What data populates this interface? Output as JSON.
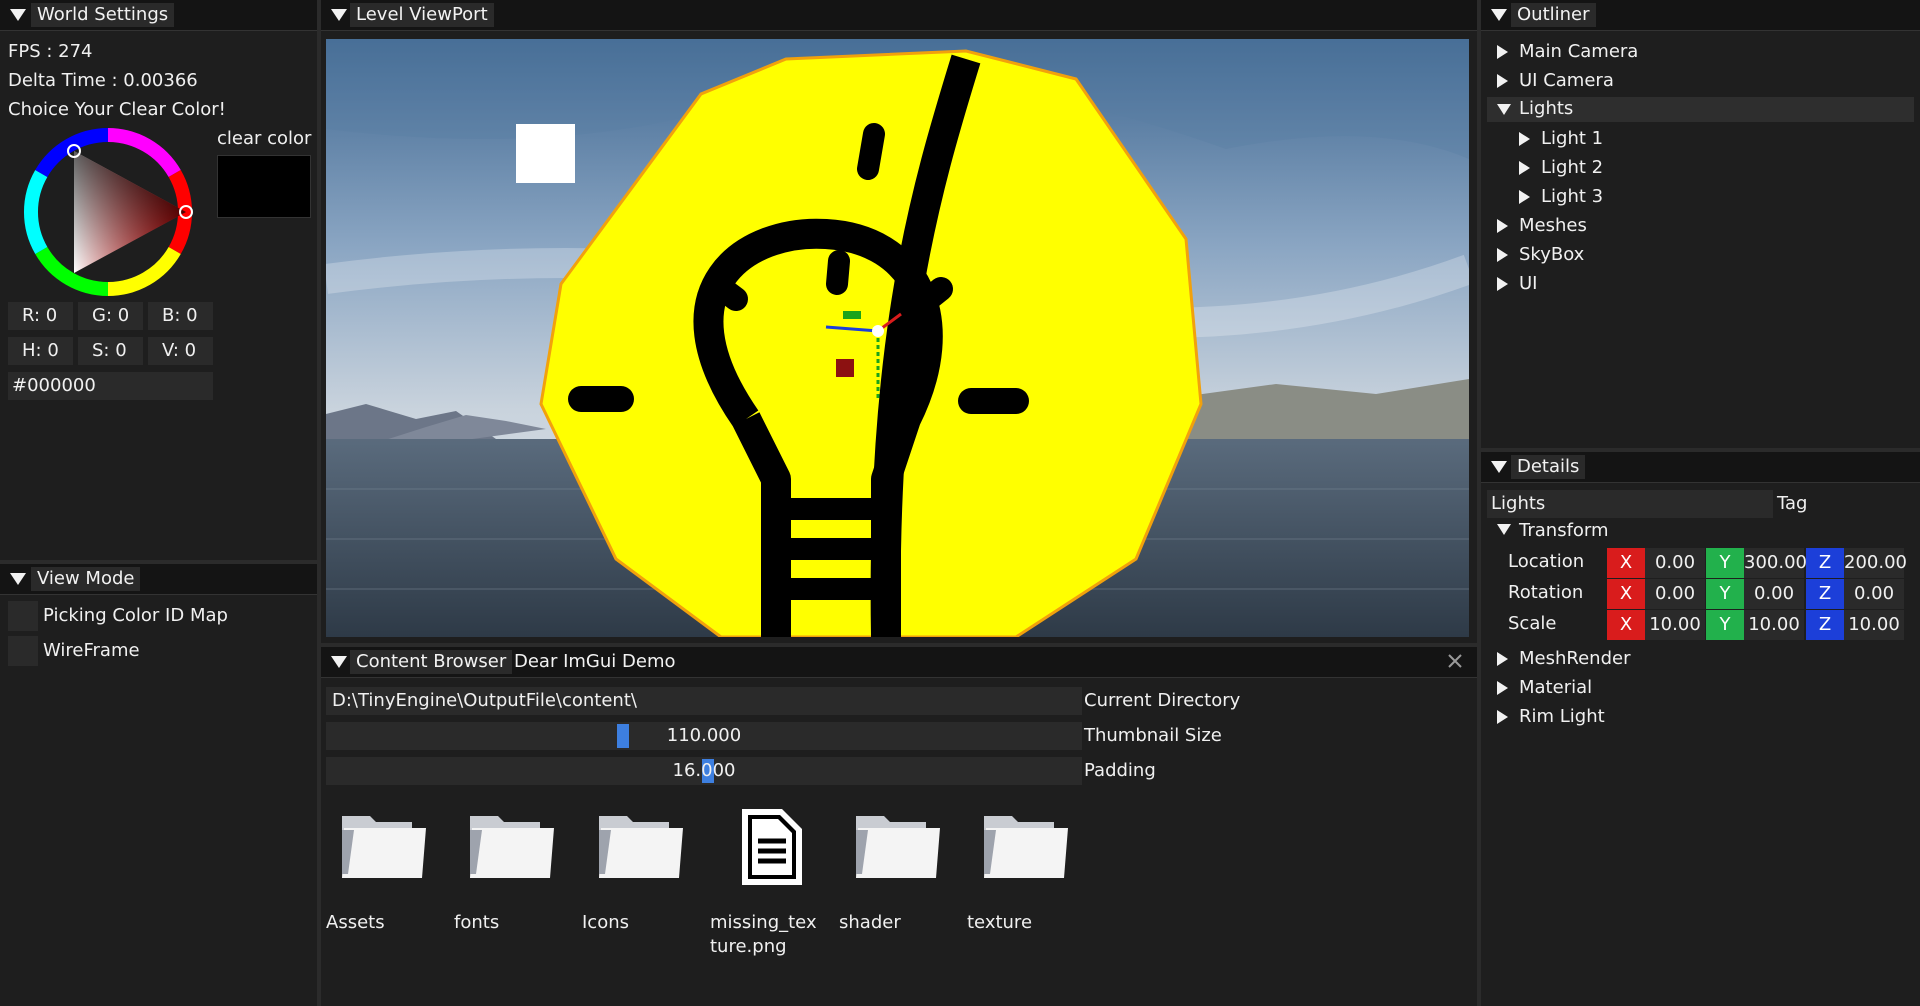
{
  "world_settings": {
    "title": "World Settings",
    "fps": "FPS : 274",
    "delta_time": "Delta Time : 0.00366",
    "choice_label": "Choice Your Clear Color!",
    "clear_color_label": "clear color",
    "r": "R:  0",
    "g": "G:  0",
    "b": "B:  0",
    "h": "H:  0",
    "s": "S:  0",
    "v": "V:  0",
    "hex": "#000000",
    "clear_color_hex": "#000000"
  },
  "view_mode": {
    "title": "View Mode",
    "options": [
      "Picking Color ID Map",
      "WireFrame"
    ]
  },
  "viewport": {
    "title": "Level ViewPort"
  },
  "outliner": {
    "title": "Outliner",
    "items": [
      "Main Camera",
      "UI Camera",
      "Lights",
      "Light 1",
      "Light 2",
      "Light 3",
      "Meshes",
      "SkyBox",
      "UI"
    ]
  },
  "details": {
    "title": "Details",
    "name_value": "Lights",
    "tag_label": "Tag",
    "transform_label": "Transform",
    "rows": [
      {
        "label": "Location",
        "x": "0.00",
        "y": "300.00",
        "z": "200.00"
      },
      {
        "label": "Rotation",
        "x": "0.00",
        "y": "0.00",
        "z": "0.00"
      },
      {
        "label": "Scale",
        "x": "10.00",
        "y": "10.00",
        "z": "10.00"
      }
    ],
    "axis_x": "X",
    "axis_y": "Y",
    "axis_z": "Z",
    "sections": [
      "MeshRender",
      "Material",
      "Rim Light"
    ]
  },
  "content_browser": {
    "tab_active": "Content Browser",
    "tab_other": "Dear ImGui Demo",
    "current_directory_value": "D:\\TinyEngine\\OutputFile\\content\\",
    "current_directory_label": "Current Directory",
    "thumbnail_size_value": "110.000",
    "thumbnail_size_label": "Thumbnail Size",
    "padding_value": "16.000",
    "padding_label": "Padding",
    "items": [
      {
        "name": "Assets",
        "icon": "folder-icon"
      },
      {
        "name": "fonts",
        "icon": "folder-icon"
      },
      {
        "name": "Icons",
        "icon": "folder-icon"
      },
      {
        "name": "missing_texture.png",
        "icon": "file-icon"
      },
      {
        "name": "shader",
        "icon": "folder-icon"
      },
      {
        "name": "texture",
        "icon": "folder-icon"
      }
    ]
  },
  "colors": {
    "axis_x": "#d91c1c",
    "axis_y": "#22b14c",
    "axis_z": "#1c3fd9",
    "highlight": "#2e2e2e",
    "slider_grab": "#3d7fe0"
  }
}
